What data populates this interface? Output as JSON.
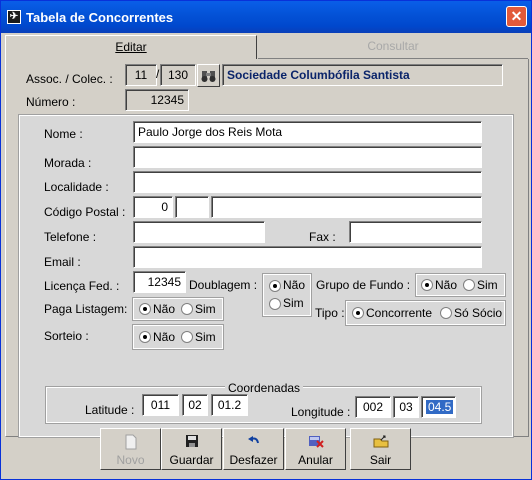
{
  "window": {
    "title": "Tabela de Concorrentes",
    "close": "✕"
  },
  "tabs": [
    {
      "label": "Editar",
      "active": true
    },
    {
      "label": "Consultar",
      "active": false
    }
  ],
  "assoc": {
    "label": "Assoc. / Colec. :",
    "assoc_value": "11",
    "separator": "/",
    "colec_value": "130",
    "name": "Sociedade Columbófila Santista"
  },
  "numero": {
    "label": "Número :",
    "value": "12345"
  },
  "form": {
    "nome": {
      "label": "Nome :",
      "value": "Paulo Jorge dos Reis Mota"
    },
    "morada": {
      "label": "Morada :",
      "value": ""
    },
    "localidade": {
      "label": "Localidade :",
      "value": ""
    },
    "codigo_postal": {
      "label": "Código Postal :",
      "value1": "0",
      "value2": "",
      "value3": ""
    },
    "telefone": {
      "label": "Telefone :",
      "value": ""
    },
    "fax": {
      "label": "Fax :",
      "value": ""
    },
    "email": {
      "label": "Email :",
      "value": ""
    },
    "licenca": {
      "label": "Licença Fed. :",
      "value": "12345"
    },
    "doublagem": {
      "label": "Doublagem :",
      "options": [
        "Não",
        "Sim"
      ],
      "selected": "Não"
    },
    "grupo_fundo": {
      "label": "Grupo de Fundo :",
      "options": [
        "Não",
        "Sim"
      ],
      "selected": "Não"
    },
    "paga_listagem": {
      "label": "Paga Listagem:",
      "options": [
        "Não",
        "Sim"
      ],
      "selected": "Não"
    },
    "tipo": {
      "label": "Tipo :",
      "options": [
        "Concorrente",
        "Só Sócio"
      ],
      "selected": "Concorrente"
    },
    "sorteio": {
      "label": "Sorteio :",
      "options": [
        "Não",
        "Sim"
      ],
      "selected": "Não"
    }
  },
  "coordenadas": {
    "legend": "Coordenadas",
    "latitude": {
      "label": "Latitude :",
      "deg": "011",
      "min": "02",
      "sec": "01.2"
    },
    "longitude": {
      "label": "Longitude :",
      "deg": "002",
      "min": "03",
      "sec": "04.5"
    }
  },
  "buttons": [
    {
      "label": "Novo",
      "icon": "document-icon",
      "enabled": false
    },
    {
      "label": "Guardar",
      "icon": "save-icon",
      "enabled": true
    },
    {
      "label": "Desfazer",
      "icon": "undo-icon",
      "enabled": true
    },
    {
      "label": "Anular",
      "icon": "delete-icon",
      "enabled": true
    },
    {
      "label": "Sair",
      "icon": "exit-icon",
      "enabled": true
    }
  ]
}
